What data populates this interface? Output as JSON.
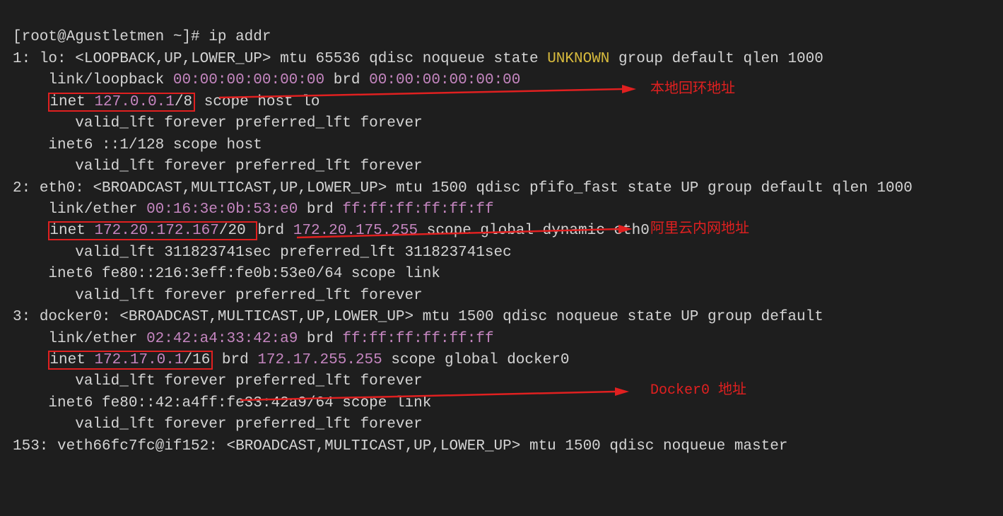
{
  "prompt": {
    "user_host": "[root@Agustletmen ~]#",
    "command": "ip addr"
  },
  "interfaces": {
    "lo": {
      "index": "1:",
      "name": "lo:",
      "flags": "<LOOPBACK,UP,LOWER_UP>",
      "attrs": "mtu 65536 qdisc noqueue state",
      "state": "UNKNOWN",
      "attrs2": "group default qlen 1000",
      "link_label": "link/loopback",
      "link_mac": "00:00:00:00:00:00",
      "brd_label": "brd",
      "brd_mac": "00:00:00:00:00:00",
      "inet_label": "inet",
      "inet_ip": "127.0.0.1",
      "inet_cidr": "/8",
      "inet_scope": "scope host lo",
      "inet_lft": "valid_lft forever preferred_lft forever",
      "inet6": "inet6 ::1/128 scope host",
      "inet6_lft": "valid_lft forever preferred_lft forever"
    },
    "eth0": {
      "index": "2:",
      "name": "eth0:",
      "flags": "<BROADCAST,MULTICAST,UP,LOWER_UP>",
      "attrs": "mtu 1500 qdisc pfifo_fast state UP group default qlen 1000",
      "link_label": "link/ether",
      "link_mac": "00:16:3e:0b:53:e0",
      "brd_label": "brd",
      "brd_mac": "ff:ff:ff:ff:ff:ff",
      "inet_label": "inet",
      "inet_ip": "172.20.172.167",
      "inet_cidr": "/20",
      "inet_brd_label": "brd",
      "inet_brd": "172.20.175.255",
      "inet_scope": "scope global dynamic eth0",
      "inet_lft": "valid_lft 311823741sec preferred_lft 311823741sec",
      "inet6": "inet6 fe80::216:3eff:fe0b:53e0/64 scope link",
      "inet6_lft": "valid_lft forever preferred_lft forever"
    },
    "docker0": {
      "index": "3:",
      "name": "docker0:",
      "flags": "<BROADCAST,MULTICAST,UP,LOWER_UP>",
      "attrs": "mtu 1500 qdisc noqueue state UP group default",
      "link_label": "link/ether",
      "link_mac": "02:42:a4:33:42:a9",
      "brd_label": "brd",
      "brd_mac": "ff:ff:ff:ff:ff:ff",
      "inet_label": "inet",
      "inet_ip": "172.17.0.1",
      "inet_cidr": "/16",
      "inet_brd_label": "brd",
      "inet_brd": "172.17.255.255",
      "inet_scope": "scope global docker0",
      "inet_lft": "valid_lft forever preferred_lft forever",
      "inet6": "inet6 fe80::42:a4ff:fe33:42a9/64 scope link",
      "inet6_lft": "valid_lft forever preferred_lft forever"
    },
    "veth": {
      "index": "153:",
      "name": "veth66fc7fc@if152:",
      "flags": "<BROADCAST,MULTICAST,UP,LOWER_UP>",
      "attrs": "mtu 1500 qdisc noqueue master"
    }
  },
  "annotations": {
    "loopback": "本地回环地址",
    "aliyun": "阿里云内网地址",
    "docker": "Docker0 地址"
  }
}
